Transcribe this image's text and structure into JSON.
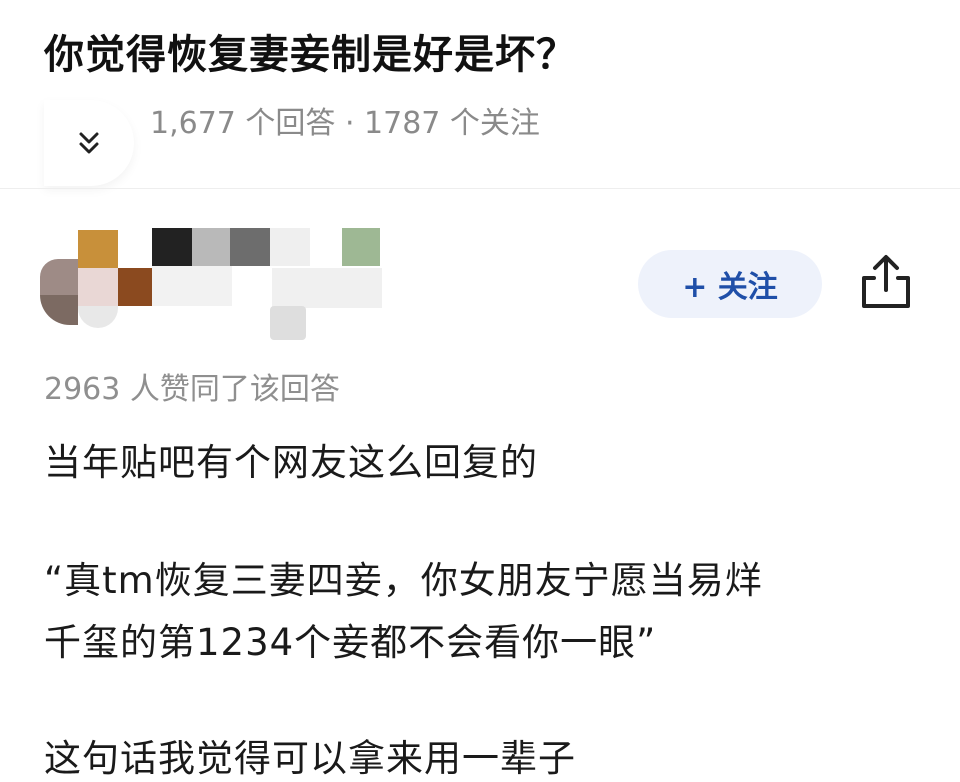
{
  "question": {
    "title": "你觉得恢复妻妾制是好是坏？",
    "meta": "1,677 个回答 · 1787 个关注"
  },
  "icons": {
    "collapse": "chevron-double-down-icon",
    "share": "share-icon"
  },
  "answer": {
    "follow_label": "+ 关注",
    "upvotes": "2963 人赞同了该回答",
    "paragraphs": [
      "当年贴吧有个网友这么回复的",
      "“真tm恢复三妻四妾，你女朋友宁愿当易烊",
      "千玺的第1234个妾都不会看你一眼”",
      "这句话我觉得可以拿来用一辈子"
    ]
  },
  "colors": {
    "follow_bg": "#eef2fb",
    "follow_text": "#1f4fa8",
    "meta_gray": "#8a8a8a"
  }
}
